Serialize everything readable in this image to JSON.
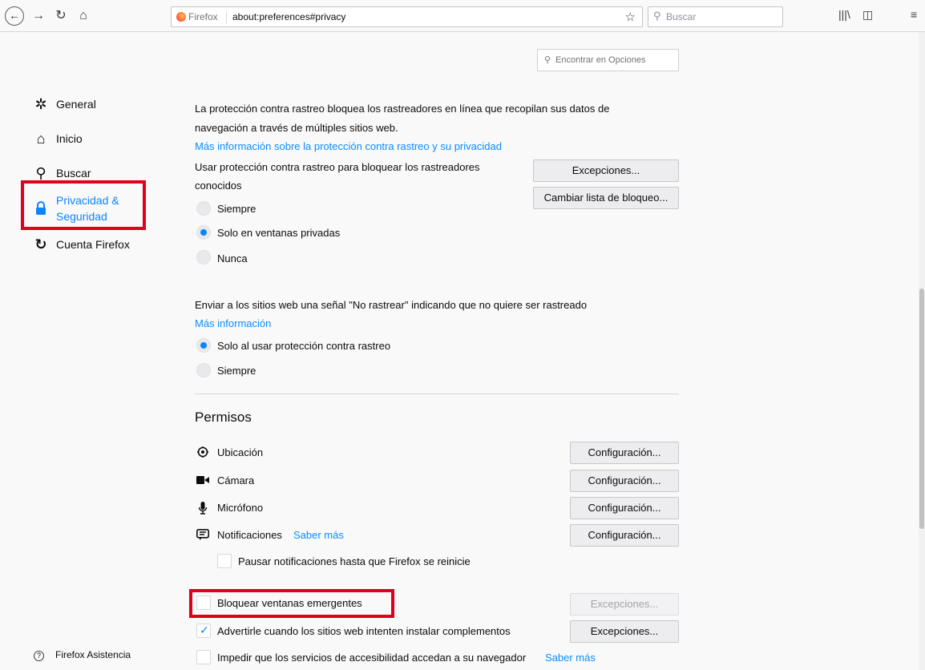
{
  "toolbar": {
    "identity_label": "Firefox",
    "url": "about:preferences#privacy",
    "search_placeholder": "Buscar"
  },
  "sidebar": {
    "items": [
      {
        "label": "General",
        "icon": "gear-icon"
      },
      {
        "label": "Inicio",
        "icon": "home-icon"
      },
      {
        "label": "Buscar",
        "icon": "search-icon"
      },
      {
        "label_line1": "Privacidad &",
        "label_line2": "Seguridad",
        "icon": "lock-icon",
        "selected": true
      },
      {
        "label": "Cuenta Firefox",
        "icon": "sync-icon"
      }
    ],
    "help_label": "Firefox Asistencia"
  },
  "find": {
    "placeholder": "Encontrar en Opciones"
  },
  "tracking": {
    "description_line1": "La protección contra rastreo bloquea los rastreadores en línea que recopilan sus datos de",
    "description_line2": "navegación a través de múltiples sitios web.",
    "learn_more": "Más información sobre la protección contra rastreo y su privacidad",
    "use_label_line1": "Usar protección contra rastreo para bloquear los rastreadores",
    "use_label_line2": "conocidos",
    "exceptions_button": "Excepciones...",
    "change_list_button": "Cambiar lista de bloqueo...",
    "options": [
      "Siempre",
      "Solo en ventanas privadas",
      "Nunca"
    ],
    "selected_option": "Solo en ventanas privadas"
  },
  "dnt": {
    "label": "Enviar a los sitios web una señal \"No rastrear\" indicando que no quiere ser rastreado",
    "learn_more": "Más información",
    "options": [
      "Solo al usar protección contra rastreo",
      "Siempre"
    ],
    "selected_option": "Solo al usar protección contra rastreo"
  },
  "permissions": {
    "title": "Permisos",
    "items": [
      {
        "label": "Ubicación",
        "button": "Configuración...",
        "icon": "location-icon"
      },
      {
        "label": "Cámara",
        "button": "Configuración...",
        "icon": "camera-icon"
      },
      {
        "label": "Micrófono",
        "button": "Configuración...",
        "icon": "microphone-icon"
      },
      {
        "label": "Notificaciones",
        "button": "Configuración...",
        "icon": "notification-icon",
        "link": "Saber más"
      }
    ],
    "pause_notifications": "Pausar notificaciones hasta que Firefox se reinicie",
    "block_popups": "Bloquear ventanas emergentes",
    "block_popups_button": "Excepciones...",
    "warn_addons": "Advertirle cuando los sitios web intenten instalar complementos",
    "warn_addons_button": "Excepciones...",
    "accessibility": "Impedir que los servicios de accesibilidad accedan a su navegador",
    "accessibility_link": "Saber más"
  },
  "colors": {
    "accent": "#0a84ff",
    "highlight": "#e1001a"
  }
}
